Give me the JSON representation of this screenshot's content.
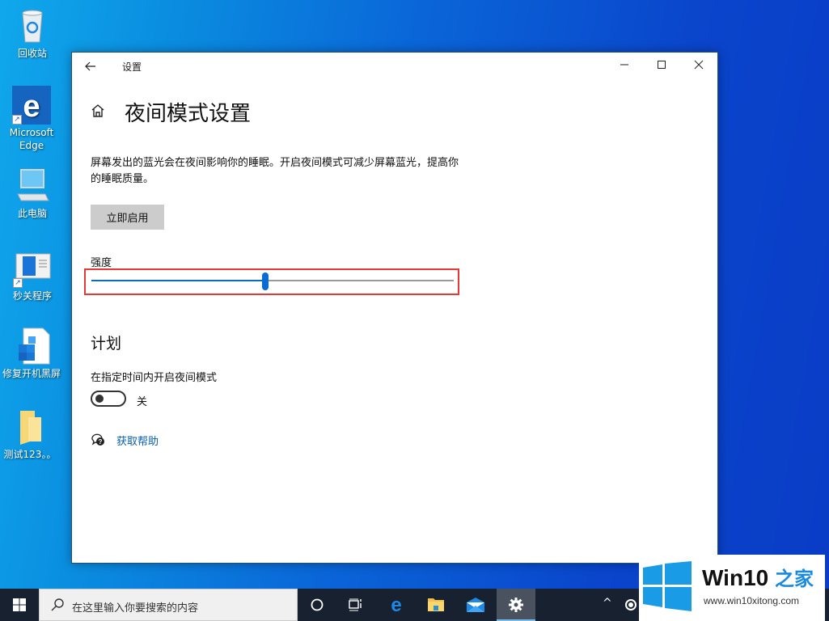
{
  "desktop": {
    "icons": [
      {
        "label": "回收站",
        "icon": "recycle-bin-icon"
      },
      {
        "label": "Microsoft Edge",
        "icon": "edge-icon",
        "shortcut": true
      },
      {
        "label": "此电脑",
        "icon": "computer-icon"
      },
      {
        "label": "秒关程序",
        "icon": "app-window-icon",
        "shortcut": true
      },
      {
        "label": "修复开机黑屏",
        "icon": "registry-file-icon"
      },
      {
        "label": "测试123。。",
        "icon": "folder-icon"
      }
    ]
  },
  "window": {
    "title": "设置",
    "back_icon": "back-arrow-icon",
    "controls": {
      "minimize": "—",
      "maximize": "☐",
      "close": "✕"
    },
    "page_title": "夜间模式设置",
    "description": "屏幕发出的蓝光会在夜间影响你的睡眠。开启夜间模式可减少屏幕蓝光，提高你的睡眠质量。",
    "enable_button": "立即启用",
    "strength": {
      "label": "强度",
      "value_fraction": 0.48,
      "accent": "#0a6bd4"
    },
    "schedule": {
      "section_title": "计划",
      "toggle_label": "在指定时间内开启夜间模式",
      "toggle_on": false,
      "toggle_state_text": "关"
    },
    "help_link": "获取帮助"
  },
  "taskbar": {
    "search_placeholder": "在这里输入你要搜索的内容",
    "buttons": [
      "cortana-icon",
      "task-view-icon",
      "edge-icon",
      "file-explorer-icon",
      "mail-icon",
      "settings-icon"
    ],
    "active": "settings-icon",
    "tray": {
      "chevron": "^"
    }
  },
  "watermark": {
    "title_main": "Win10 ",
    "title_accent": "之家",
    "url": "www.win10xitong.com"
  }
}
